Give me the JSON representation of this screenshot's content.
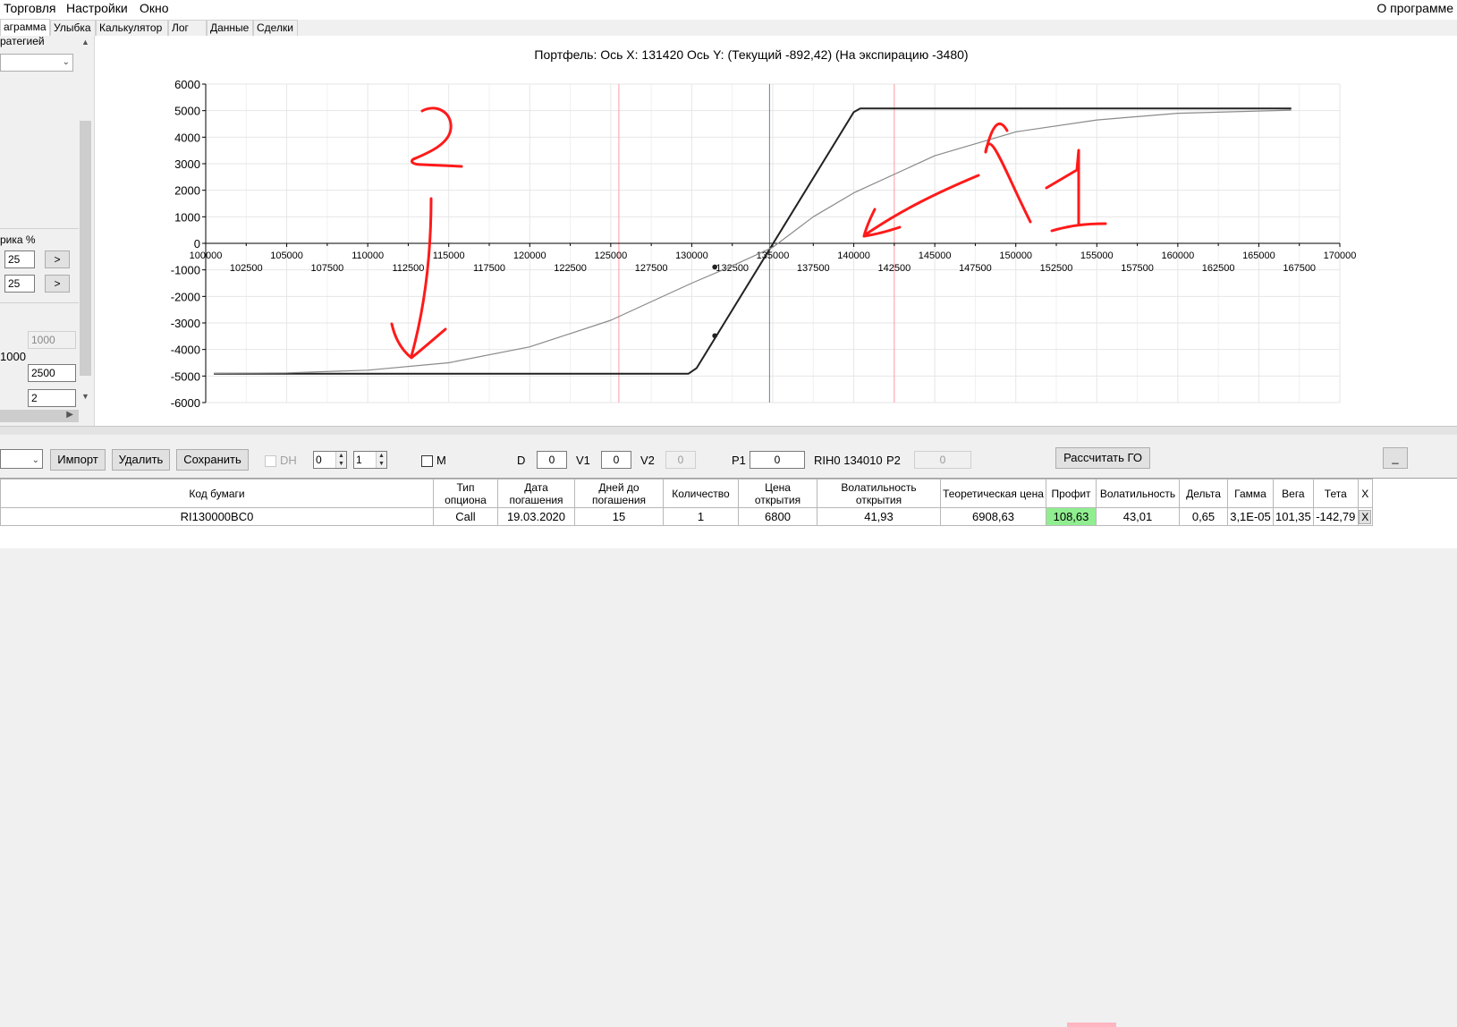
{
  "menu": {
    "items": [
      "Торговля",
      "Настройки",
      "Окно"
    ],
    "about": "О программе"
  },
  "tabs": [
    {
      "label": "аграмма"
    },
    {
      "label": "Улыбка"
    },
    {
      "label": "Калькулятор"
    },
    {
      "label": "Лог"
    },
    {
      "label": "Данные"
    },
    {
      "label": "Сделки"
    }
  ],
  "left_panel": {
    "strategy_label": "ратегией",
    "rate_label": "рика %",
    "rate_value_1": "25",
    "rate_value_2": "25",
    "step_button": ">",
    "field_1000": "1000",
    "label_1000": "1000",
    "field_2500": "2500",
    "field_2": "2"
  },
  "chart_header": {
    "portfolio_label": "Портфель: Ось X: 131420 Ось Y:  (Текущий -892,42)  (На экспирацию -3480)"
  },
  "chart_data": {
    "type": "line",
    "xlim": [
      100000,
      170000
    ],
    "ylim": [
      -6000,
      6000
    ],
    "x_ticks_top": [
      100000,
      105000,
      110000,
      115000,
      120000,
      125000,
      130000,
      135000,
      140000,
      145000,
      150000,
      155000,
      160000,
      165000,
      170000
    ],
    "x_ticks_bottom": [
      102500,
      107500,
      112500,
      117500,
      122500,
      127500,
      132500,
      137500,
      142500,
      147500,
      152500,
      157500,
      162500,
      167500
    ],
    "y_ticks": [
      6000,
      5000,
      4000,
      3000,
      2000,
      1000,
      0,
      -1000,
      -2000,
      -3000,
      -4000,
      -5000,
      -6000
    ],
    "vertical_lines": [
      {
        "x": 125500,
        "color": "#ff9aa8"
      },
      {
        "x": 134800,
        "color": "#6b7f95"
      },
      {
        "x": 142500,
        "color": "#ff9aa8"
      }
    ],
    "series": [
      {
        "style": "expiration",
        "color": "#222222",
        "x": [
          100500,
          129800,
          130300,
          140000,
          140400,
          167000
        ],
        "y": [
          -4910,
          -4910,
          -4700,
          4950,
          5080,
          5080
        ]
      },
      {
        "style": "current",
        "color": "#8a8a8a",
        "x": [
          100500,
          105000,
          110000,
          115000,
          120000,
          125000,
          130000,
          132500,
          135000,
          137500,
          140000,
          145000,
          150000,
          155000,
          160000,
          167000
        ],
        "y": [
          -4900,
          -4880,
          -4780,
          -4500,
          -3900,
          -2900,
          -1500,
          -850,
          -150,
          1000,
          1900,
          3300,
          4200,
          4650,
          4900,
          5020
        ]
      }
    ],
    "markers": [
      {
        "x": 131420,
        "y": -3480
      },
      {
        "x": 131420,
        "y": -892
      }
    ],
    "annotations": [
      {
        "text": "2",
        "x": 112500,
        "y": 2800
      },
      {
        "text": "1",
        "x": 153500,
        "y": 1500
      }
    ]
  },
  "toolbar": {
    "import": "Импорт",
    "delete": "Удалить",
    "save": "Сохранить",
    "dh": "DH",
    "spin1": "0",
    "spin2": "1",
    "m": "M",
    "d_label": "D",
    "d_value": "0",
    "v1_label": "V1",
    "v1_value": "0",
    "v2_label": "V2",
    "v2_value": "0",
    "p1_label": "P1",
    "p1_value": "0",
    "ticker": "RIH0 134010",
    "p2_label": "P2",
    "p2_value": "0",
    "calc_go": "Рассчитать ГО",
    "minimize": "_"
  },
  "table": {
    "headers": [
      "Код бумаги",
      "Тип опциона",
      "Дата погашения",
      "Дней до погашения",
      "Количество",
      "Цена открытия",
      "Волатильность открытия",
      "Теоретическая цена",
      "Профит",
      "Волатильность",
      "Дельта",
      "Гамма",
      "Вега",
      "Тета",
      "X"
    ],
    "rows": [
      [
        "RI130000BC0",
        "Call",
        "19.03.2020",
        "15",
        "1",
        "6800",
        "41,93",
        "6908,63",
        "108,63",
        "43,01",
        "0,65",
        "3,1E-05",
        "101,35",
        "-142,79",
        "X"
      ]
    ],
    "highlight": {
      "profit": "#90ee90"
    }
  }
}
